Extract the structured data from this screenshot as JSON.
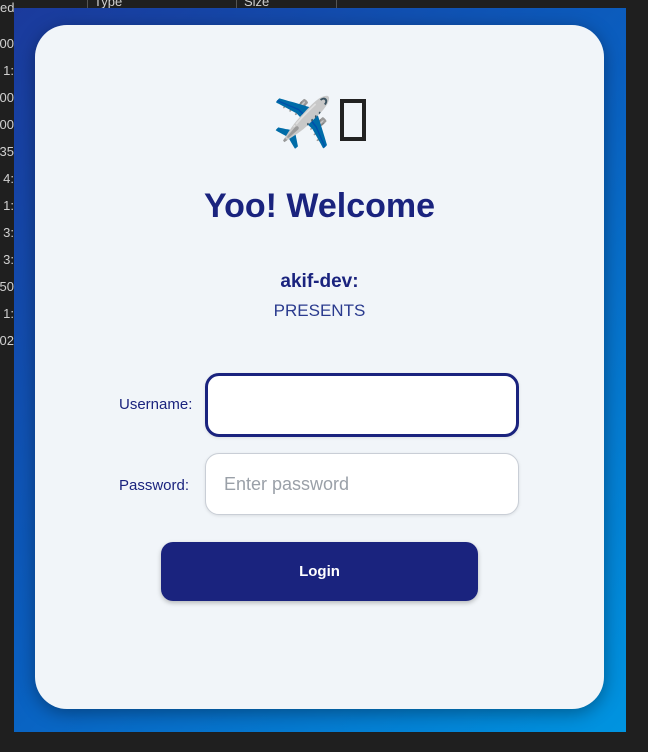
{
  "background": {
    "header_columns": [
      "Type",
      "Size"
    ],
    "left_top_text": "ed",
    "left_list": [
      "00",
      ":1",
      "00",
      "00",
      "35",
      ":4",
      ":1",
      ":3",
      ":3",
      "50",
      ":1",
      "02"
    ]
  },
  "app": {
    "logo": {
      "airplane_glyph": "✈️",
      "box_glyph_icon": "missing-glyph-box"
    },
    "title": "Yoo! Welcome",
    "author": "akif-dev:",
    "presents": "PRESENTS",
    "form": {
      "username": {
        "label": "Username:",
        "value": "",
        "placeholder": ""
      },
      "password": {
        "label": "Password:",
        "value": "",
        "placeholder": "Enter password"
      },
      "login_label": "Login"
    },
    "colors": {
      "primary": "#1a237e",
      "card_bg": "#f1f5f9",
      "window_gradient_start": "#1b3a9c",
      "window_gradient_end": "#0094e0"
    }
  }
}
